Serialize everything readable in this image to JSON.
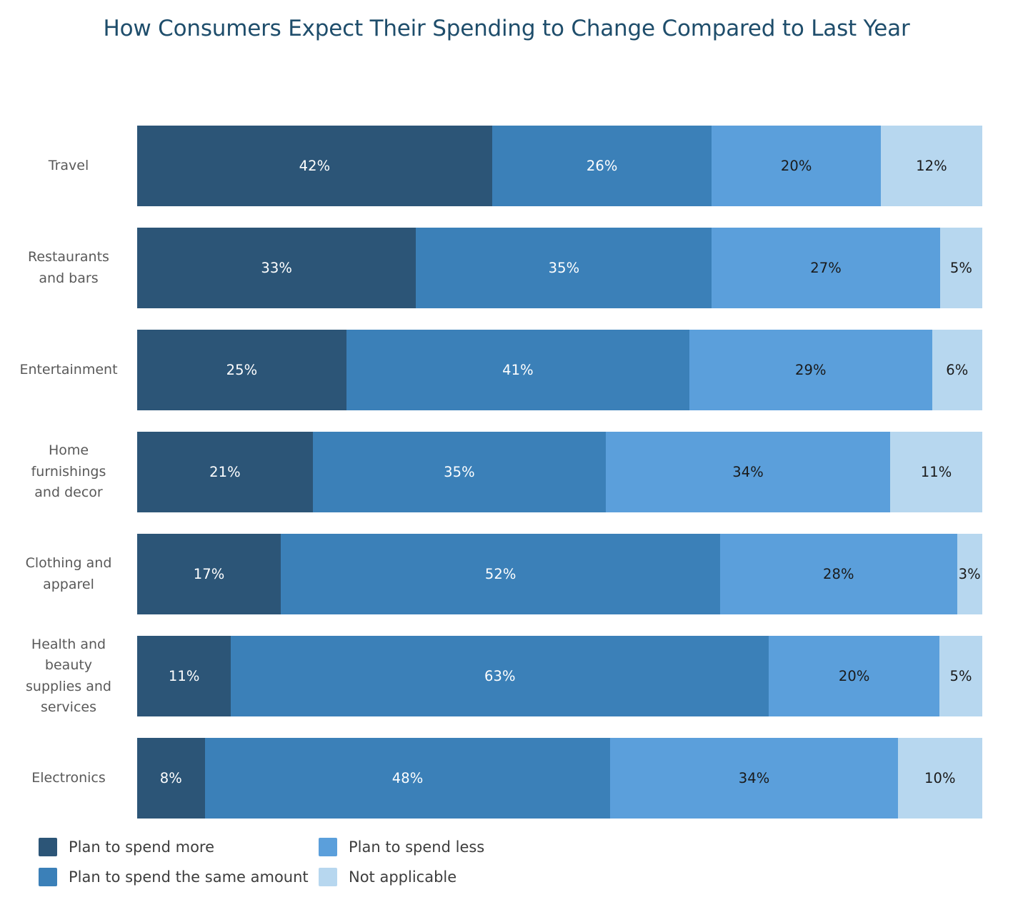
{
  "chart_data": {
    "type": "bar",
    "subtype": "stacked-horizontal-100",
    "title": "How Consumers Expect Their Spending to Change Compared to Last Year",
    "xlabel": "",
    "ylabel": "",
    "xlim": [
      0,
      100
    ],
    "grid": false,
    "legend_position": "bottom-left",
    "orientation": "horizontal",
    "stacked": true,
    "value_suffix": "%",
    "categories": [
      "Travel",
      "Restaurants and bars",
      "Entertainment",
      "Home furnishings and decor",
      "Clothing and apparel",
      "Health and beauty supplies and services",
      "Electronics"
    ],
    "category_display": [
      "Travel",
      "Restaurants\nand bars",
      "Entertainment",
      "Home\nfurnishings\nand decor",
      "Clothing and\napparel",
      "Health and\nbeauty\nsupplies and\nservices",
      "Electronics"
    ],
    "series": [
      {
        "name": "Plan to spend more",
        "color": "#2c5577",
        "label_color": "#ffffff",
        "values": [
          42,
          33,
          25,
          21,
          17,
          11,
          8
        ],
        "labels": [
          "42%",
          "33%",
          "25%",
          "21%",
          "17%",
          "11%",
          "8%"
        ]
      },
      {
        "name": "Plan to spend the same amount",
        "color": "#3b80b8",
        "label_color": "#ffffff",
        "values": [
          26,
          35,
          41,
          35,
          52,
          63,
          48
        ],
        "labels": [
          "26%",
          "35%",
          "41%",
          "35%",
          "52%",
          "63%",
          "48%"
        ]
      },
      {
        "name": "Plan to spend less",
        "color": "#5b9fdb",
        "label_color": "#1a1a1a",
        "values": [
          20,
          27,
          29,
          34,
          28,
          20,
          34
        ],
        "labels": [
          "20%",
          "27%",
          "29%",
          "34%",
          "28%",
          "20%",
          "34%"
        ]
      },
      {
        "name": "Not applicable",
        "color": "#b7d7ef",
        "label_color": "#1a1a1a",
        "values": [
          12,
          5,
          6,
          11,
          3,
          5,
          10
        ],
        "labels": [
          "12%",
          "5%",
          "6%",
          "11%",
          "3%",
          "5%",
          "10%"
        ]
      }
    ]
  },
  "title_color": "#1e4d6b",
  "background_color": "#ffffff",
  "legend": [
    {
      "label": "Plan to spend more",
      "color": "#2c5577"
    },
    {
      "label": "Plan to spend the same amount",
      "color": "#3b80b8"
    },
    {
      "label": "Plan to spend less",
      "color": "#5b9fdb"
    },
    {
      "label": "Not applicable",
      "color": "#b7d7ef"
    }
  ]
}
